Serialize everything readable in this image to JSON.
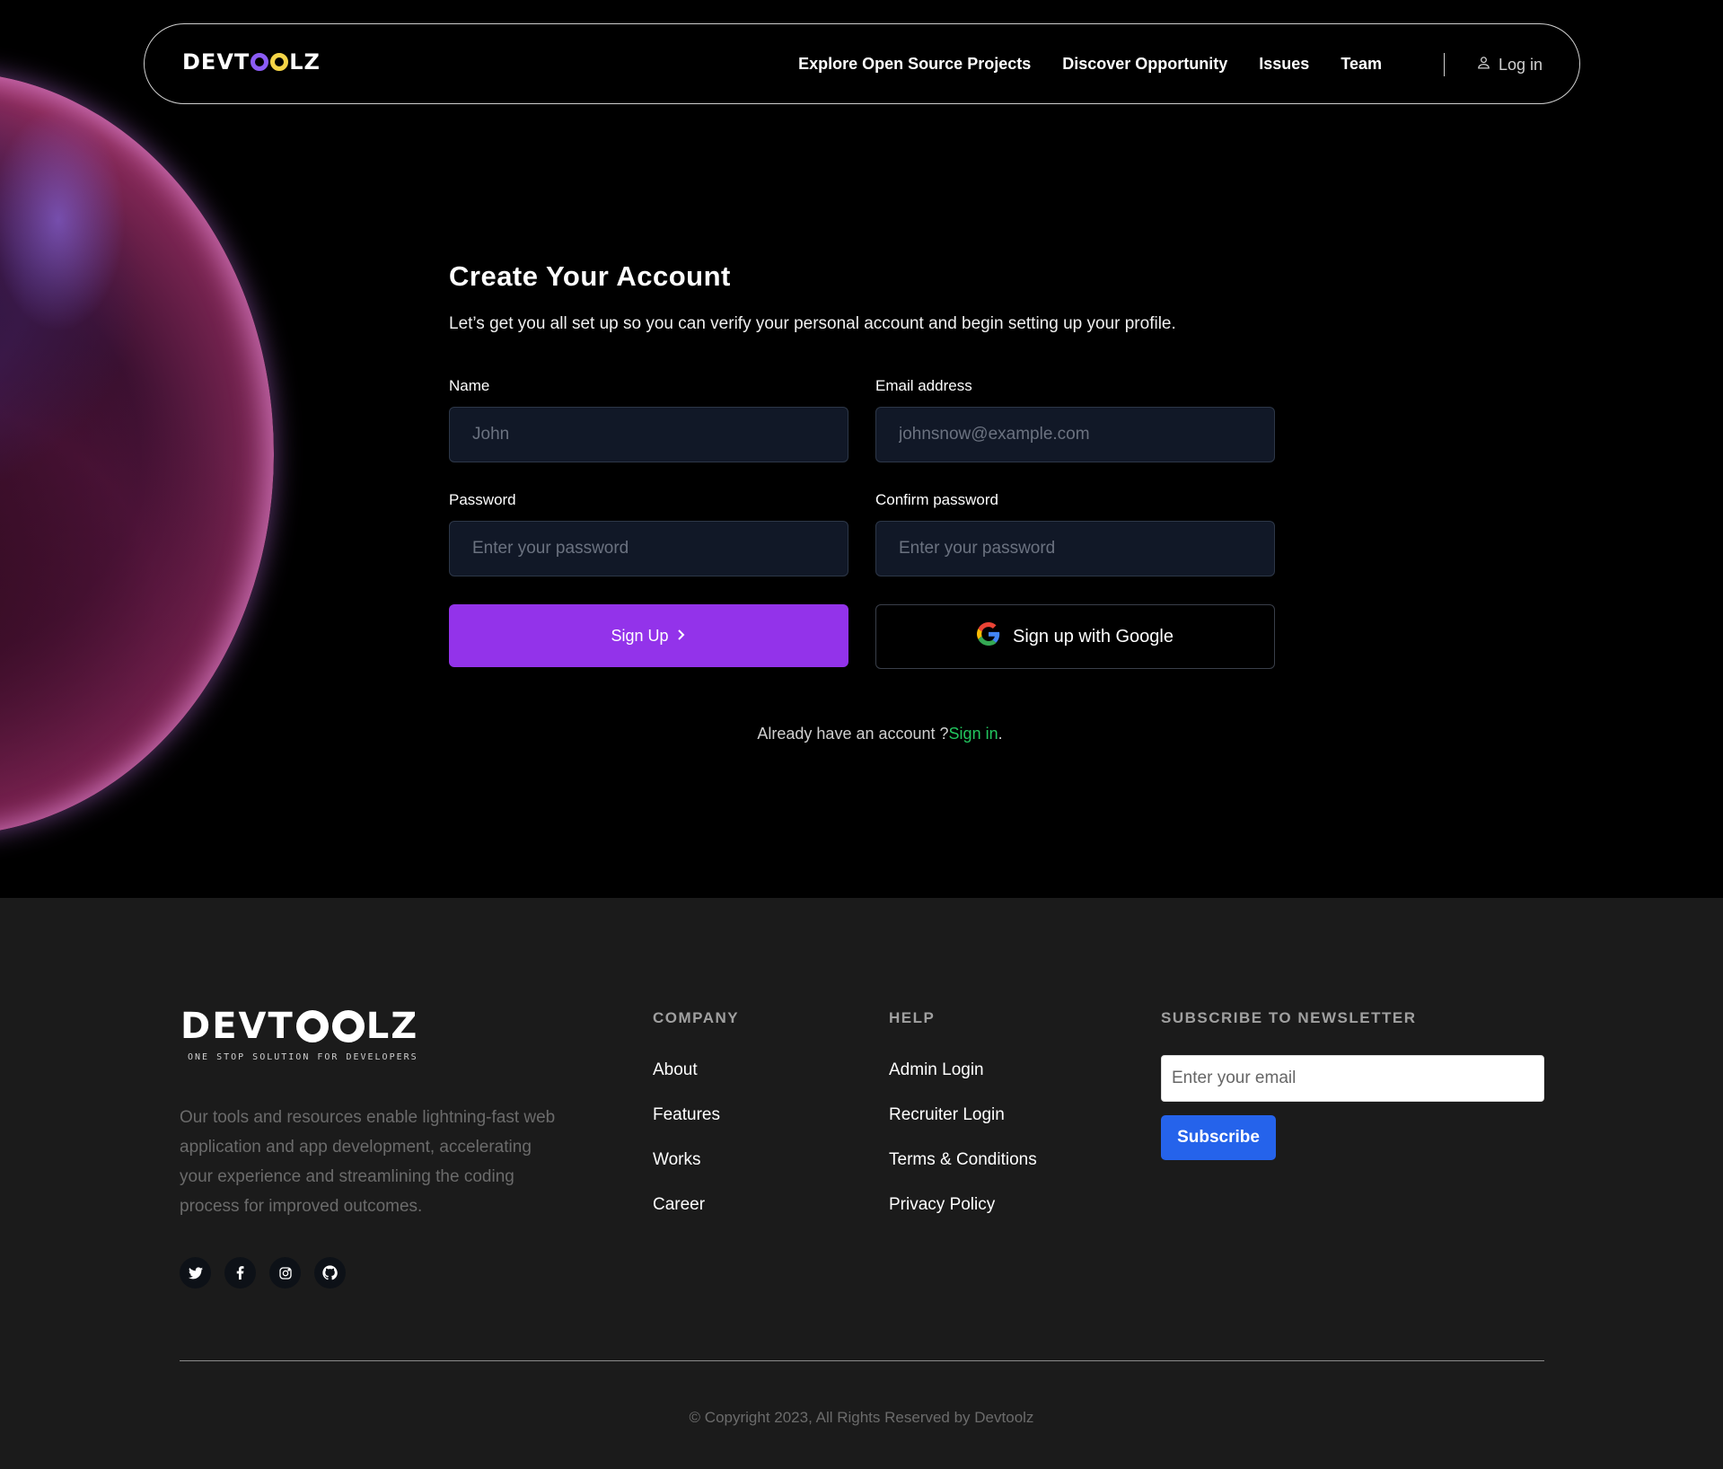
{
  "brand": {
    "logo_prefix": "DEVT",
    "logo_suffix": "LZ",
    "tagline": "ONE STOP SOLUTION FOR DEVELOPERS",
    "ring_colors": [
      "#8b5cf6",
      "#f5d547"
    ]
  },
  "nav": {
    "links": [
      "Explore Open Source Projects",
      "Discover Opportunity",
      "Issues",
      "Team"
    ],
    "login_label": "Log in",
    "login_icon": "user-icon"
  },
  "form": {
    "title": "Create Your Account",
    "subtitle": "Let’s get you all set up so you can verify your personal account and begin setting up your profile.",
    "name_label": "Name",
    "name_placeholder": "John",
    "email_label": "Email address",
    "email_placeholder": "johnsnow@example.com",
    "password_label": "Password",
    "password_placeholder": "Enter your password",
    "confirm_label": "Confirm password",
    "confirm_placeholder": "Enter your password",
    "signup_label": "Sign Up",
    "signup_icon": "chevron-right-icon",
    "google_label": "Sign up with Google",
    "google_icon": "google-icon",
    "signin_prompt": "Already have an account ?",
    "signin_link": "Sign in",
    "signin_suffix": "."
  },
  "footer": {
    "description": "Our tools and resources enable lightning-fast web application and app development, accelerating your experience and streamlining the coding process for improved outcomes.",
    "socials": [
      "twitter-icon",
      "facebook-icon",
      "instagram-icon",
      "github-icon"
    ],
    "company_heading": "COMPANY",
    "company_links": [
      "About",
      "Features",
      "Works",
      "Career"
    ],
    "help_heading": "HELP",
    "help_links": [
      "Admin Login",
      "Recruiter Login",
      "Terms & Conditions",
      "Privacy Policy"
    ],
    "newsletter_heading": "SUBSCRIBE TO NEWSLETTER",
    "newsletter_placeholder": "Enter your email",
    "subscribe_label": "Subscribe",
    "copyright": "© Copyright 2023, All Rights Reserved by Devtoolz"
  },
  "colors": {
    "accent_purple": "#9333ea",
    "link_green": "#22c55e",
    "subscribe_blue": "#2563eb",
    "footer_bg": "#1b1b1b"
  }
}
